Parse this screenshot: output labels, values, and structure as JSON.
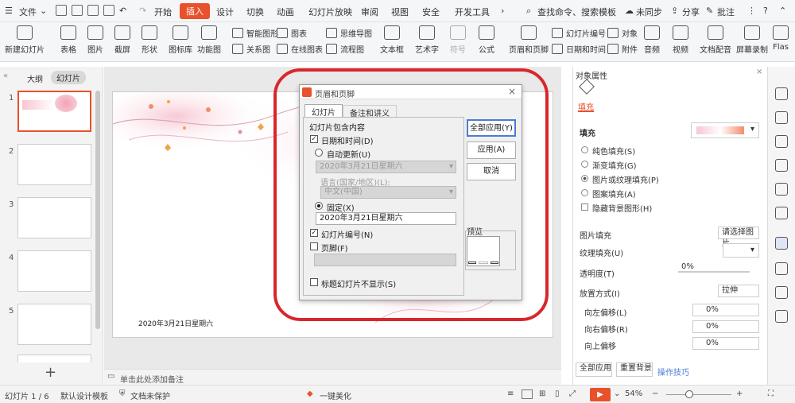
{
  "menubar": {
    "file": "文件",
    "tabs": [
      "开始",
      "插入",
      "设计",
      "切换",
      "动画",
      "幻灯片放映",
      "审阅",
      "视图",
      "安全",
      "开发工具"
    ],
    "active_tab": "插入",
    "search": "查找命令、搜索模板",
    "sync": "未同步",
    "share": "分享",
    "comment": "批注"
  },
  "ribbon": {
    "new_slide": "新建幻灯片",
    "table": "表格",
    "picture": "图片",
    "screenshot": "截屏",
    "shape": "形状",
    "icon_lib": "图标库",
    "func_chart": "功能图",
    "smart_art": "智能图形",
    "chart": "图表",
    "relation": "关系图",
    "online_chart": "在线图表",
    "mindmap": "思维导图",
    "flowchart": "流程图",
    "textbox": "文本框",
    "wordart": "艺术字",
    "symbol": "符号",
    "formula": "公式",
    "header_footer": "页眉和页脚",
    "slide_number": "幻灯片编号",
    "object": "对象",
    "date_time": "日期和时间",
    "attachment": "附件",
    "audio": "音频",
    "video": "视频",
    "doc_voice": "文档配音",
    "screen_record": "屏幕录制",
    "flash": "Flas"
  },
  "leftpane": {
    "tab_outline": "大纲",
    "tab_slides": "幻灯片",
    "slide_numbers": [
      "1",
      "2",
      "3",
      "4",
      "5"
    ]
  },
  "slide": {
    "date_text": "2020年3月21日星期六"
  },
  "notes_placeholder": "单击此处添加备注",
  "dialog": {
    "title": "页眉和页脚",
    "tab_slides": "幻灯片",
    "tab_notes": "备注和讲义",
    "group_label": "幻灯片包含内容",
    "date_time": "日期和时间(D)",
    "auto_update": "自动更新(U)",
    "auto_date_value": "2020年3月21日星期六",
    "language_label": "语言(国家/地区)(L):",
    "language_value": "中文(中国)",
    "fixed": "固定(X)",
    "fixed_value": "2020年3月21日星期六",
    "slide_number": "幻灯片编号(N)",
    "footer": "页脚(F)",
    "hide_on_title": "标题幻灯片不显示(S)",
    "btn_apply_all": "全部应用(Y)",
    "btn_apply": "应用(A)",
    "btn_cancel": "取消",
    "preview": "预览"
  },
  "rightpane": {
    "title": "对象属性",
    "tab_fill": "填充",
    "section_fill": "填充",
    "opt_solid": "纯色填充(S)",
    "opt_gradient": "渐变填充(G)",
    "opt_picture": "图片或纹理填充(P)",
    "opt_pattern": "图案填充(A)",
    "hide_bg": "隐藏背景图形(H)",
    "pic_fill_label": "图片填充",
    "pic_fill_value": "请选择图片",
    "texture_label": "纹理填充(U)",
    "transparency_label": "透明度(T)",
    "transparency_value": "0%",
    "placement_label": "放置方式(I)",
    "placement_value": "拉伸",
    "offset_left_label": "向左偏移(L)",
    "offset_left_value": "0%",
    "offset_right_label": "向右偏移(R)",
    "offset_right_value": "0%",
    "offset_up_label": "向上偏移",
    "offset_up_value": "0%",
    "btn_apply_all": "全部应用",
    "btn_reset_bg": "重置背景",
    "tips": "操作技巧"
  },
  "statusbar": {
    "slide_count": "幻灯片 1 / 6",
    "template": "默认设计模板",
    "protect": "文档未保护",
    "beautify": "一键美化",
    "zoom": "54%"
  },
  "colors": {
    "accent": "#e8512b",
    "annotation_ring": "#d9262c"
  }
}
